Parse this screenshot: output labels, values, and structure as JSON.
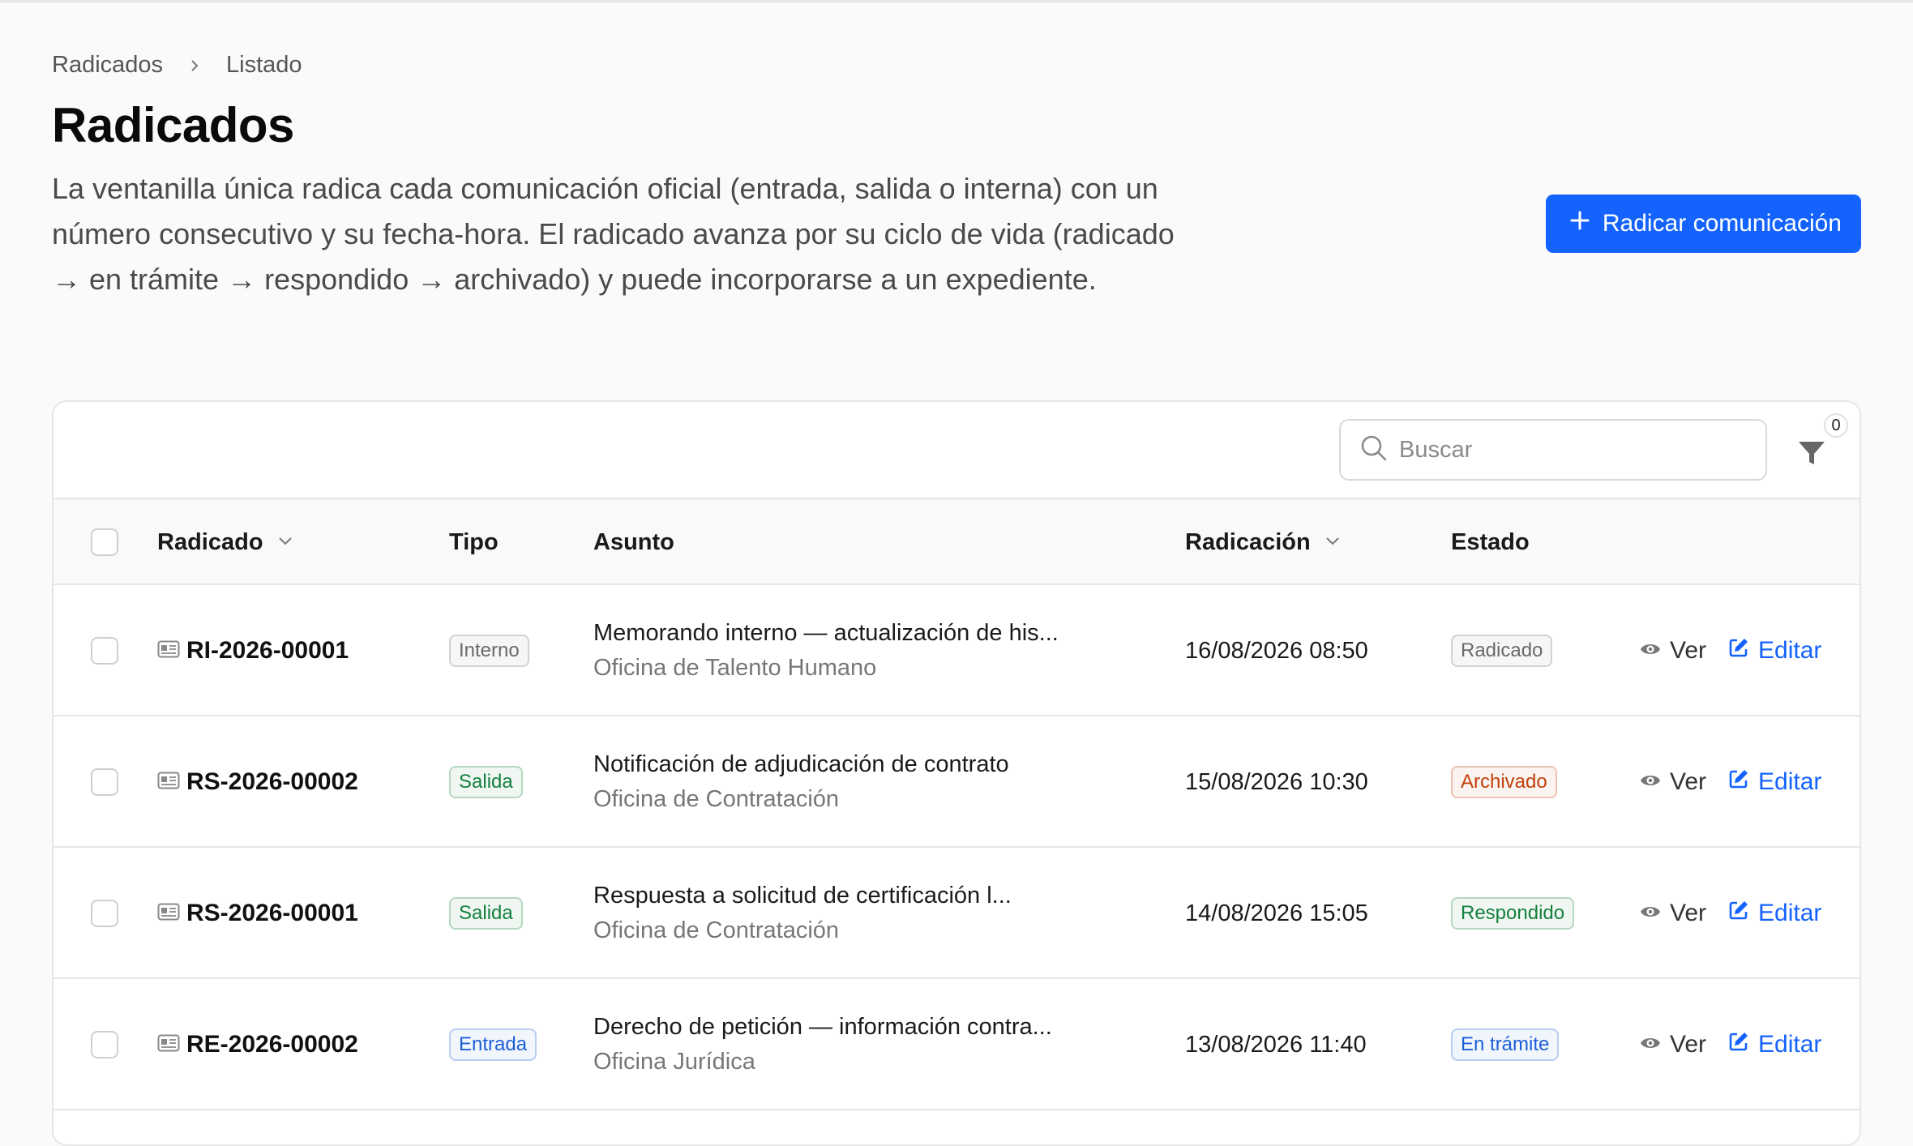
{
  "breadcrumb": {
    "root": "Radicados",
    "current": "Listado"
  },
  "page": {
    "title": "Radicados",
    "description": "La ventanilla única radica cada comunicación oficial (entrada, salida o interna) con un número consecutivo y su fecha-hora. El radicado avanza por su ciclo de vida (radicado → en trámite → respondido → archivado) y puede incorporarse a un expediente."
  },
  "actions": {
    "create_label": "Radicar comunicación"
  },
  "toolbar": {
    "search_placeholder": "Buscar",
    "filter_count": "0"
  },
  "table": {
    "columns": {
      "radicado": "Radicado",
      "tipo": "Tipo",
      "asunto": "Asunto",
      "radicacion": "Radicación",
      "estado": "Estado"
    },
    "view_label": "Ver",
    "edit_label": "Editar",
    "rows": [
      {
        "id": "RI-2026-00001",
        "tipo": "Interno",
        "tipo_color": "#6b6b6b",
        "asunto": "Memorando interno — actualización de his...",
        "oficina": "Oficina de Talento Humano",
        "fecha": "16/08/2026 08:50",
        "estado": "Radicado",
        "estado_color": "#6b6b6b"
      },
      {
        "id": "RS-2026-00002",
        "tipo": "Salida",
        "tipo_color": "#15803d",
        "asunto": "Notificación de adjudicación de contrato",
        "oficina": "Oficina de Contratación",
        "fecha": "15/08/2026 10:30",
        "estado": "Archivado",
        "estado_color": "#c2410c"
      },
      {
        "id": "RS-2026-00001",
        "tipo": "Salida",
        "tipo_color": "#15803d",
        "asunto": "Respuesta a solicitud de certificación l...",
        "oficina": "Oficina de Contratación",
        "fecha": "14/08/2026 15:05",
        "estado": "Respondido",
        "estado_color": "#15803d"
      },
      {
        "id": "RE-2026-00002",
        "tipo": "Entrada",
        "tipo_color": "#1d5fd6",
        "asunto": "Derecho de petición — información contra...",
        "oficina": "Oficina Jurídica",
        "fecha": "13/08/2026 11:40",
        "estado": "En trámite",
        "estado_color": "#1d5fd6"
      }
    ]
  }
}
